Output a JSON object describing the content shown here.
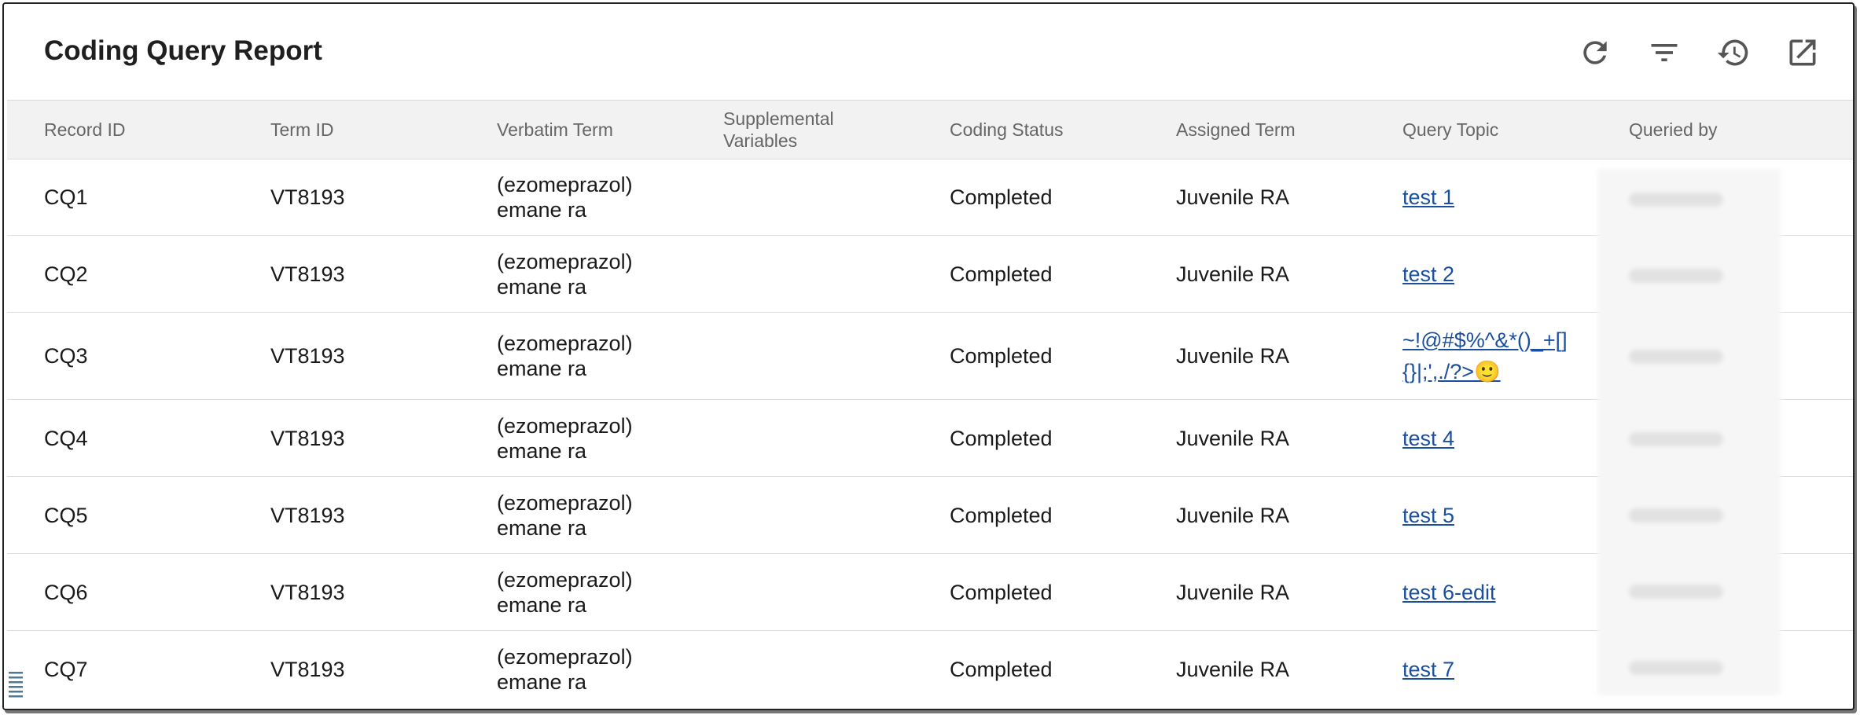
{
  "title": "Coding Query Report",
  "toolbar": {
    "refresh_icon": "refresh-icon",
    "filter_icon": "filter-icon",
    "history_icon": "history-icon",
    "open_external_icon": "open-in-new-icon"
  },
  "columns": {
    "record_id": "Record ID",
    "term_id": "Term ID",
    "verbatim": "Verbatim Term",
    "supplemental_1": "Supplemental",
    "supplemental_2": "Variables",
    "coding_status": "Coding Status",
    "assigned_term": "Assigned Term",
    "query_topic": "Query Topic",
    "queried_by": "Queried by"
  },
  "rows": [
    {
      "record_id": "CQ1",
      "term_id": "VT8193",
      "verbatim_1": "(ezomeprazol)",
      "verbatim_2": "emane ra",
      "status": "Completed",
      "assigned": "Juvenile RA",
      "topic_1": "test 1",
      "topic_2": ""
    },
    {
      "record_id": "CQ2",
      "term_id": "VT8193",
      "verbatim_1": "(ezomeprazol)",
      "verbatim_2": "emane ra",
      "status": "Completed",
      "assigned": "Juvenile RA",
      "topic_1": "test 2",
      "topic_2": ""
    },
    {
      "record_id": "CQ3",
      "term_id": "VT8193",
      "verbatim_1": "(ezomeprazol)",
      "verbatim_2": "emane ra",
      "status": "Completed",
      "assigned": "Juvenile RA",
      "topic_1": "~!@#$%^&*()_+[]",
      "topic_2": "{}|;',./?>🙂"
    },
    {
      "record_id": "CQ4",
      "term_id": "VT8193",
      "verbatim_1": "(ezomeprazol)",
      "verbatim_2": "emane ra",
      "status": "Completed",
      "assigned": "Juvenile RA",
      "topic_1": "test 4",
      "topic_2": ""
    },
    {
      "record_id": "CQ5",
      "term_id": "VT8193",
      "verbatim_1": "(ezomeprazol)",
      "verbatim_2": "emane ra",
      "status": "Completed",
      "assigned": "Juvenile RA",
      "topic_1": "test 5",
      "topic_2": ""
    },
    {
      "record_id": "CQ6",
      "term_id": "VT8193",
      "verbatim_1": "(ezomeprazol)",
      "verbatim_2": "emane ra",
      "status": "Completed",
      "assigned": "Juvenile RA",
      "topic_1": "test 6-edit",
      "topic_2": ""
    },
    {
      "record_id": "CQ7",
      "term_id": "VT8193",
      "verbatim_1": "(ezomeprazol)",
      "verbatim_2": "emane ra",
      "status": "Completed",
      "assigned": "Juvenile RA",
      "topic_1": "test 7",
      "topic_2": ""
    }
  ],
  "colors": {
    "link": "#1a4fa0",
    "header_bg": "#f2f2f2",
    "title": "#1f1f1f"
  }
}
